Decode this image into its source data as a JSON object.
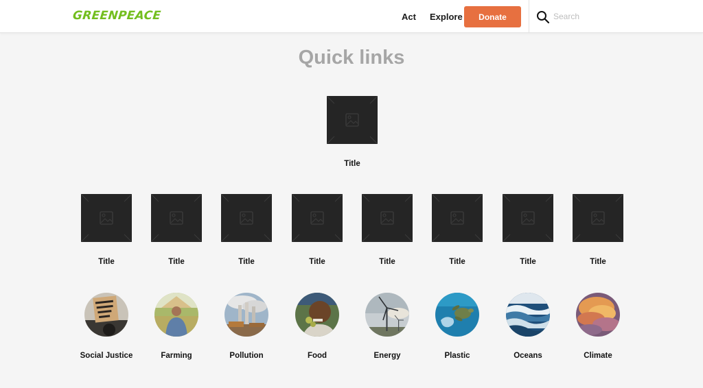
{
  "header": {
    "logo_text": "GREENPEACE",
    "nav": {
      "act_label": "Act",
      "explore_label": "Explore"
    },
    "donate_label": "Donate",
    "search_placeholder": "Search"
  },
  "main": {
    "title": "Quick links",
    "featured": {
      "label": "Title"
    },
    "tiles": [
      {
        "label": "Title"
      },
      {
        "label": "Title"
      },
      {
        "label": "Title"
      },
      {
        "label": "Title"
      },
      {
        "label": "Title"
      },
      {
        "label": "Title"
      },
      {
        "label": "Title"
      },
      {
        "label": "Title"
      }
    ],
    "categories": [
      {
        "label": "Social Justice",
        "image": "protest-sign"
      },
      {
        "label": "Farming",
        "image": "farmer-hat"
      },
      {
        "label": "Pollution",
        "image": "smokestacks"
      },
      {
        "label": "Food",
        "image": "person-eating"
      },
      {
        "label": "Energy",
        "image": "wind-turbines"
      },
      {
        "label": "Plastic",
        "image": "turtle-plastic"
      },
      {
        "label": "Oceans",
        "image": "ocean-waves"
      },
      {
        "label": "Climate",
        "image": "fiery-clouds"
      }
    ]
  },
  "colors": {
    "brand_green": "#73be1e",
    "donate": "#e77040",
    "title_gray": "#a6a6a6",
    "placeholder_bg": "#252525"
  }
}
